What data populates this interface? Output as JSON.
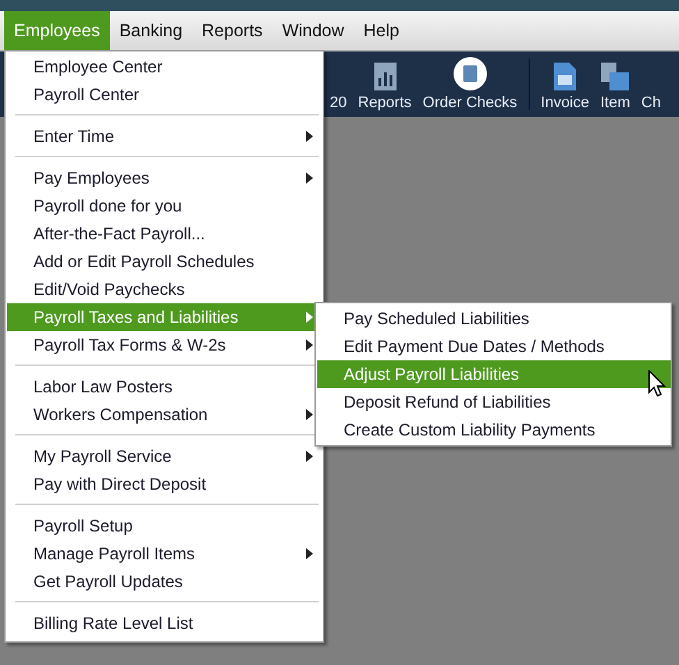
{
  "menubar": [
    {
      "label": "Employees",
      "selected": true
    },
    {
      "label": "Banking",
      "selected": false
    },
    {
      "label": "Reports",
      "selected": false
    },
    {
      "label": "Window",
      "selected": false
    },
    {
      "label": "Help",
      "selected": false
    }
  ],
  "toolbar": [
    {
      "label": "20",
      "kind": "text"
    },
    {
      "label": "Reports",
      "kind": "chart"
    },
    {
      "label": "Order Checks",
      "kind": "checks"
    },
    {
      "label": "Invoice",
      "kind": "invoice"
    },
    {
      "label": "Item",
      "kind": "item"
    },
    {
      "label": "Ch",
      "kind": "text"
    }
  ],
  "menu": {
    "groups": [
      [
        {
          "label": "Employee Center",
          "submenu": false,
          "selected": false
        },
        {
          "label": "Payroll Center",
          "submenu": false,
          "selected": false
        }
      ],
      [
        {
          "label": "Enter Time",
          "submenu": true,
          "selected": false
        }
      ],
      [
        {
          "label": "Pay Employees",
          "submenu": true,
          "selected": false
        },
        {
          "label": "Payroll done for you",
          "submenu": false,
          "selected": false
        },
        {
          "label": "After-the-Fact Payroll...",
          "submenu": false,
          "selected": false
        },
        {
          "label": "Add or Edit Payroll Schedules",
          "submenu": false,
          "selected": false
        },
        {
          "label": "Edit/Void Paychecks",
          "submenu": false,
          "selected": false
        },
        {
          "label": "Payroll Taxes and Liabilities",
          "submenu": true,
          "selected": true
        },
        {
          "label": "Payroll Tax Forms & W-2s",
          "submenu": true,
          "selected": false
        }
      ],
      [
        {
          "label": "Labor Law Posters",
          "submenu": false,
          "selected": false
        },
        {
          "label": "Workers Compensation",
          "submenu": true,
          "selected": false
        }
      ],
      [
        {
          "label": "My Payroll Service",
          "submenu": true,
          "selected": false
        },
        {
          "label": "Pay with Direct Deposit",
          "submenu": false,
          "selected": false
        }
      ],
      [
        {
          "label": "Payroll Setup",
          "submenu": false,
          "selected": false
        },
        {
          "label": "Manage Payroll Items",
          "submenu": true,
          "selected": false
        },
        {
          "label": "Get Payroll Updates",
          "submenu": false,
          "selected": false
        }
      ],
      [
        {
          "label": "Billing Rate Level List",
          "submenu": false,
          "selected": false
        }
      ]
    ]
  },
  "submenu": [
    {
      "label": "Pay Scheduled Liabilities",
      "selected": false
    },
    {
      "label": "Edit Payment Due Dates / Methods",
      "selected": false
    },
    {
      "label": "Adjust Payroll Liabilities",
      "selected": true
    },
    {
      "label": "Deposit Refund of Liabilities",
      "selected": false
    },
    {
      "label": "Create Custom Liability Payments",
      "selected": false
    }
  ]
}
